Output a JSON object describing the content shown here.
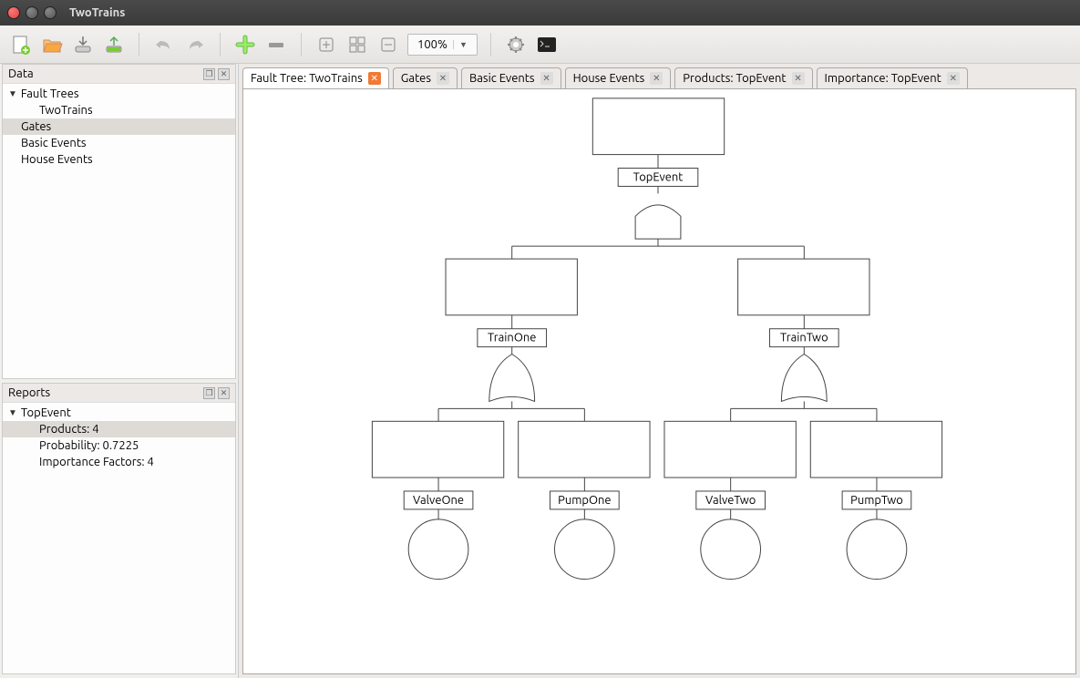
{
  "window": {
    "title": "TwoTrains"
  },
  "toolbar": {
    "zoom": "100%"
  },
  "sidebar": {
    "data_panel": {
      "title": "Data",
      "items": [
        {
          "label": "Fault Trees",
          "indent": 0,
          "expandable": true
        },
        {
          "label": "TwoTrains",
          "indent": 2,
          "expandable": false
        },
        {
          "label": "Gates",
          "indent": 1,
          "expandable": false,
          "selected": true
        },
        {
          "label": "Basic Events",
          "indent": 1,
          "expandable": false
        },
        {
          "label": "House Events",
          "indent": 1,
          "expandable": false
        }
      ]
    },
    "reports_panel": {
      "title": "Reports",
      "items": [
        {
          "label": "TopEvent",
          "indent": 0,
          "expandable": true
        },
        {
          "label": "Products: 4",
          "indent": 2,
          "expandable": false,
          "selected": true
        },
        {
          "label": "Probability: 0.7225",
          "indent": 2,
          "expandable": false
        },
        {
          "label": "Importance Factors: 4",
          "indent": 2,
          "expandable": false
        }
      ]
    }
  },
  "tabs": [
    {
      "label": "Fault Tree: TwoTrains",
      "active": true,
      "close": "orange"
    },
    {
      "label": "Gates",
      "active": false,
      "close": "gray"
    },
    {
      "label": "Basic Events",
      "active": false,
      "close": "gray"
    },
    {
      "label": "House Events",
      "active": false,
      "close": "gray"
    },
    {
      "label": "Products: TopEvent",
      "active": false,
      "close": "gray"
    },
    {
      "label": "Importance: TopEvent",
      "active": false,
      "close": "gray"
    }
  ],
  "diagram": {
    "top": {
      "label": "TopEvent",
      "gate": "and"
    },
    "left": {
      "label": "TrainOne",
      "gate": "or"
    },
    "right": {
      "label": "TrainTwo",
      "gate": "or"
    },
    "leaves": [
      {
        "label": "ValveOne"
      },
      {
        "label": "PumpOne"
      },
      {
        "label": "ValveTwo"
      },
      {
        "label": "PumpTwo"
      }
    ]
  }
}
